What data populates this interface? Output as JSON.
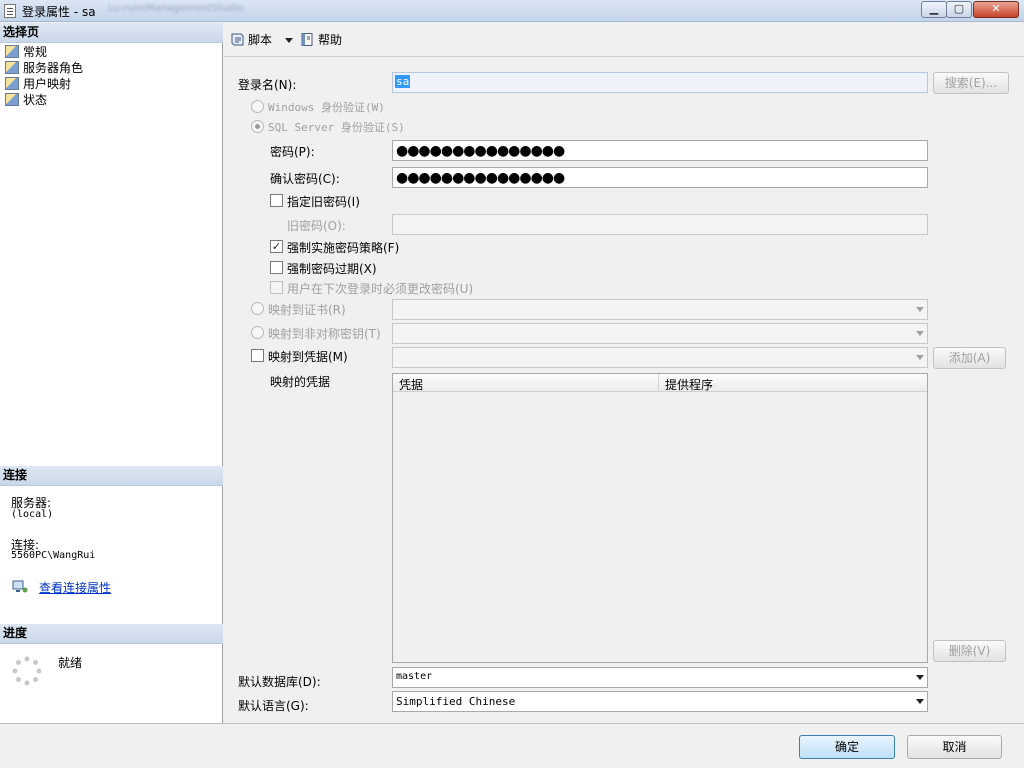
{
  "window": {
    "title": "登录属性 - sa",
    "subtitle": "Lu-rulo\\ManagementStudio",
    "min": "▁",
    "max": "▢",
    "close": "✕"
  },
  "left": {
    "select_page_header": "选择页",
    "pages": [
      "常规",
      "服务器角色",
      "用户映射",
      "状态"
    ],
    "connection_header": "连接",
    "server_label": "服务器:",
    "server_value": "(local)",
    "connection_label": "连接:",
    "connection_value": "5560PC\\WangRui",
    "view_props_link": "查看连接属性",
    "progress_header": "进度",
    "progress_status": "就绪"
  },
  "toolbar": {
    "script_label": "脚本",
    "help_label": "帮助"
  },
  "form": {
    "login_name_label": "登录名(N):",
    "login_name_value": "sa",
    "search_button": "搜索(E)...",
    "windows_auth": "Windows 身份验证(W)",
    "sql_auth": "SQL Server 身份验证(S)",
    "password_label": "密码(P):",
    "password_value": "●●●●●●●●●●●●●●●",
    "confirm_label": "确认密码(C):",
    "confirm_value": "●●●●●●●●●●●●●●●",
    "specify_old": "指定旧密码(I)",
    "old_password_label": "旧密码(O):",
    "enforce_policy": "强制实施密码策略(F)",
    "enforce_policy_checked": true,
    "enforce_expiration": "强制密码过期(X)",
    "must_change": "用户在下次登录时必须更改密码(U)",
    "map_cert": "映射到证书(R)",
    "map_asym": "映射到非对称密钥(T)",
    "map_cred": "映射到凭据(M)",
    "add_button": "添加(A)",
    "mapped_creds_label": "映射的凭据",
    "grid_col_cred": "凭据",
    "grid_col_provider": "提供程序",
    "remove_button": "删除(V)",
    "default_db_label": "默认数据库(D):",
    "default_db_value": "master",
    "default_lang_label": "默认语言(G):",
    "default_lang_value": "Simplified Chinese"
  },
  "footer": {
    "ok": "确定",
    "cancel": "取消"
  }
}
